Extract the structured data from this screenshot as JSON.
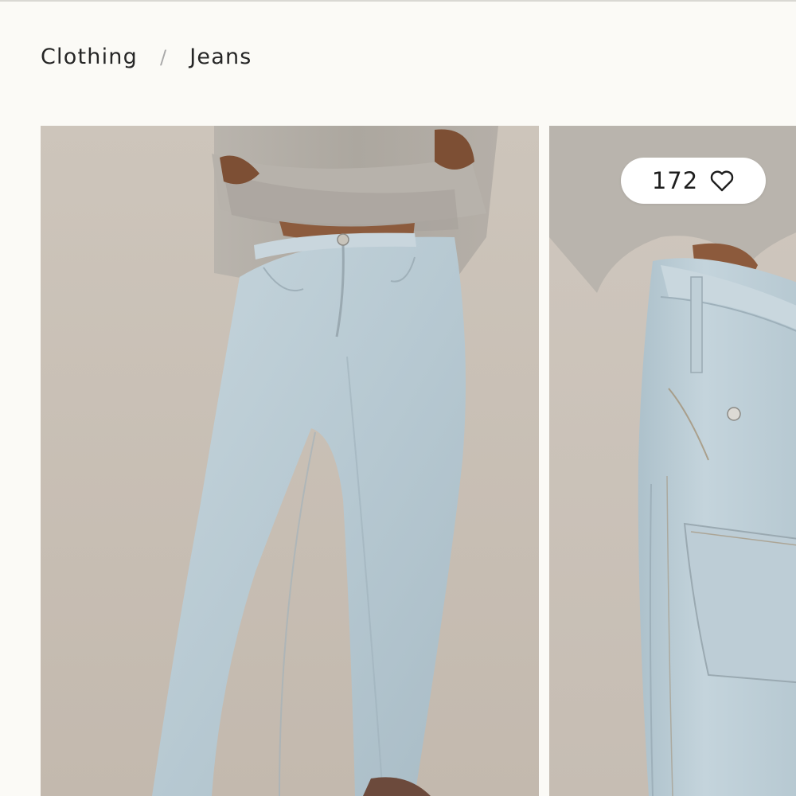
{
  "breadcrumb": {
    "items": [
      {
        "label": "Clothing"
      },
      {
        "label": "Jeans"
      }
    ],
    "separator": "/"
  },
  "gallery": {
    "images": [
      {
        "alt": "Model wearing light wash straight jeans with grey cardigan"
      },
      {
        "alt": "Close-up of jeans waistband and front pocket"
      }
    ]
  },
  "likes": {
    "count": "172",
    "icon": "heart-outline-icon"
  },
  "colors": {
    "background": "#fbfaf6",
    "text": "#262626",
    "denim": "#bccdd6",
    "cardigan": "#b2ada6"
  }
}
